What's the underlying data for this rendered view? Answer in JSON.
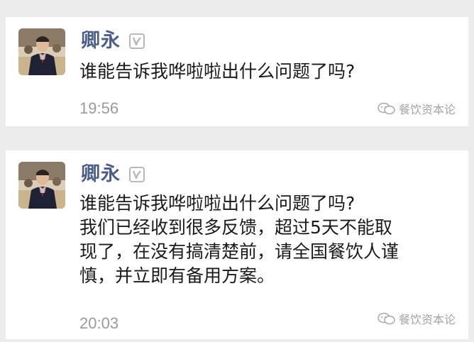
{
  "posts": [
    {
      "author": "卿永",
      "lines": [
        "谁能告诉我哗啦啦出什么问题了吗?"
      ],
      "time": "19:56",
      "watermark": "餐饮资本论"
    },
    {
      "author": "卿永",
      "lines": [
        "谁能告诉我哗啦啦出什么问题了吗?",
        "我们已经收到很多反馈，超过5天不能取",
        "现了，在没有搞清楚前，请全国餐饮人谨",
        "慎，并立即有备用方案。"
      ],
      "time": "20:03",
      "watermark": "餐饮资本论"
    }
  ],
  "colors": {
    "author": "#4b5e88",
    "text": "#1a1a1a",
    "time": "#9a9a9a",
    "background": "#ececec"
  }
}
